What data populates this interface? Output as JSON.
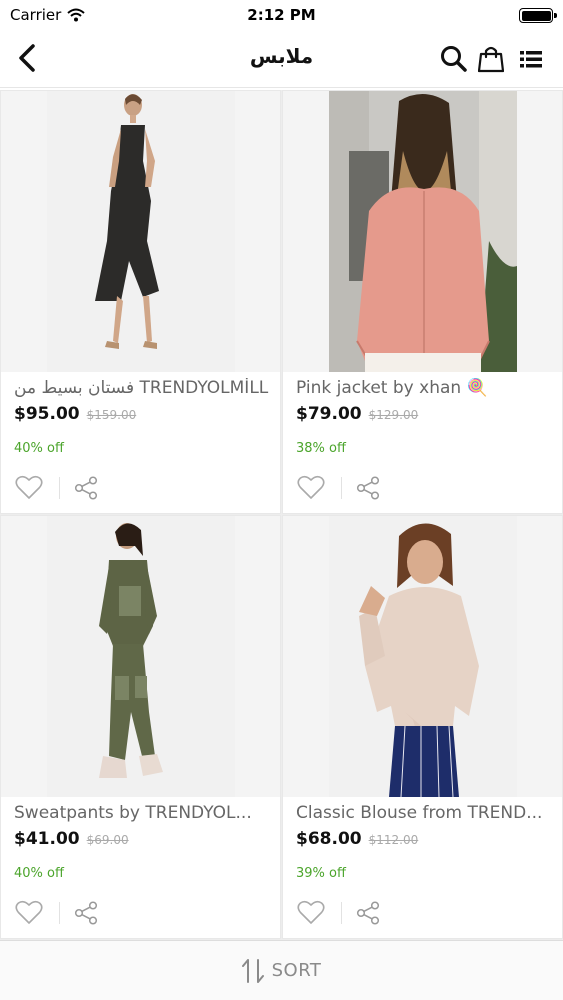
{
  "status_bar": {
    "carrier": "Carrier",
    "time": "2:12 PM"
  },
  "nav": {
    "title": "ملابس",
    "back_icon": "chevron-left-icon",
    "search_icon": "search-icon",
    "cart_icon": "shopping-bag-icon",
    "view_icon": "list-view-icon"
  },
  "products": [
    {
      "name": "فستان بسيط من TRENDYOLMİLL",
      "price": "$95.00",
      "old_price": "$159.00",
      "discount": "40% off"
    },
    {
      "name": "Pink jacket by xhan 🍭",
      "price": "$79.00",
      "old_price": "$129.00",
      "discount": "38% off"
    },
    {
      "name": "Sweatpants by TRENDYOL...",
      "price": "$41.00",
      "old_price": "$69.00",
      "discount": "40% off"
    },
    {
      "name": "Classic Blouse from TREND...",
      "price": "$68.00",
      "old_price": "$112.00",
      "discount": "39% off"
    }
  ],
  "sort": {
    "label": "SORT",
    "icon": "sort-arrows-icon"
  },
  "colors": {
    "discount_green": "#4ca52c",
    "price_text": "#111111",
    "muted_text": "#666666"
  }
}
